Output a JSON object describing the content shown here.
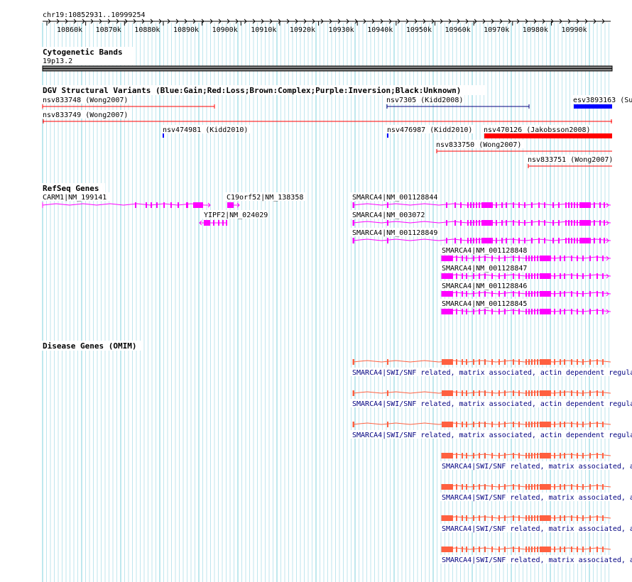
{
  "ruler": {
    "label": "chr19:10852931..10999254",
    "ticks": [
      "10860k",
      "10870k",
      "10880k",
      "10890k",
      "10900k",
      "10910k",
      "10920k",
      "10930k",
      "10940k",
      "10950k",
      "10960k",
      "10970k",
      "10980k",
      "10990k"
    ]
  },
  "cytoband": {
    "title": "Cytogenetic Bands",
    "band": "19p13.2"
  },
  "dgv": {
    "title": "DGV Structural Variants (Blue:Gain;Red:Loss;Brown:Complex;Purple:Inversion;Black:Unknown)",
    "colors": {
      "gain": "#0000ff",
      "loss": "#ff0000",
      "unknown_line": "#000080"
    },
    "variants": [
      {
        "label": "nsv833748 (Wong2007)",
        "color": "loss-thin"
      },
      {
        "label": "nsv7305 (Kidd2008)",
        "color": "unknown-thin"
      },
      {
        "label": "esv3893163 (Su",
        "color": "gain-thick"
      },
      {
        "label": "nsv833749 (Wong2007)",
        "color": "loss-thin"
      },
      {
        "label": "nsv474981 (Kidd2010)",
        "color": "gain-point"
      },
      {
        "label": "nsv476987 (Kidd2010)",
        "color": "gain-point"
      },
      {
        "label": "nsv470126 (Jakobsson2008)",
        "color": "loss-thick"
      },
      {
        "label": "nsv833750 (Wong2007)",
        "color": "loss-thin"
      },
      {
        "label": "nsv833751 (Wong2007)",
        "color": "loss-thin"
      }
    ]
  },
  "refseq": {
    "title": "RefSeq Genes",
    "color": "#ff00ff",
    "genes": [
      "CARM1|NM_199141",
      "C19orf52|NM_138358",
      "YIPF2|NM_024029",
      "SMARCA4|NM_001128844",
      "SMARCA4|NM_003072",
      "SMARCA4|NM_001128849",
      "SMARCA4|NM_001128848",
      "SMARCA4|NM_001128847",
      "SMARCA4|NM_001128846",
      "SMARCA4|NM_001128845"
    ]
  },
  "omim": {
    "title": "Disease Genes (OMIM)",
    "color": "#ff6040",
    "label_long": "SMARCA4|SWI/SNF related, matrix associated, actin dependent regula",
    "label_short": "SMARCA4|SWI/SNF related, matrix associated, a"
  }
}
